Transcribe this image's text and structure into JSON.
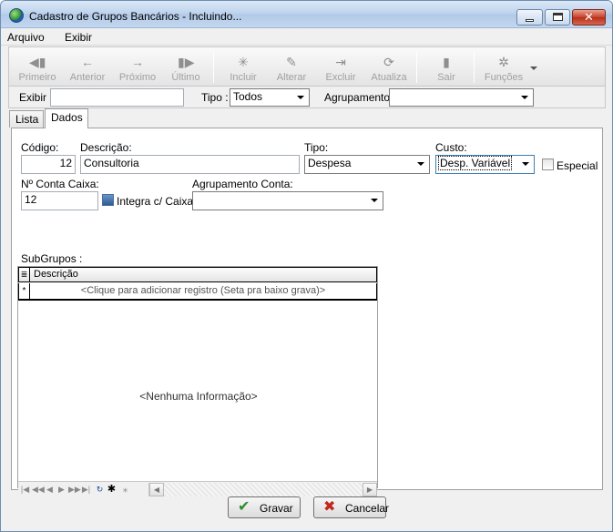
{
  "window": {
    "title": "Cadastro de Grupos Bancários - Incluindo..."
  },
  "menu": {
    "items": [
      "Arquivo",
      "Exibir"
    ]
  },
  "toolbar": {
    "buttons": [
      {
        "label": "Primeiro",
        "icon": "first-record-icon",
        "glyph": "◀▮"
      },
      {
        "label": "Anterior",
        "icon": "previous-arrow-icon",
        "glyph": "←"
      },
      {
        "label": "Próximo",
        "icon": "next-arrow-icon",
        "glyph": "→"
      },
      {
        "label": "Último",
        "icon": "last-record-icon",
        "glyph": "▮▶"
      },
      {
        "label": "Incluir",
        "icon": "new-record-icon",
        "glyph": "✳"
      },
      {
        "label": "Alterar",
        "icon": "edit-record-icon",
        "glyph": "✎"
      },
      {
        "label": "Excluir",
        "icon": "delete-record-icon",
        "glyph": "⇥"
      },
      {
        "label": "Atualiza",
        "icon": "refresh-icon",
        "glyph": "⟳"
      },
      {
        "label": "Sair",
        "icon": "exit-door-icon",
        "glyph": "▮"
      },
      {
        "label": "Funções",
        "icon": "functions-tools-icon",
        "glyph": "✲"
      }
    ]
  },
  "filter": {
    "exibir_label": "Exibir :",
    "exibir_value": "",
    "tipo_label": "Tipo :",
    "tipo_value": "Todos",
    "agrupamento_label": "Agrupamento:",
    "agrupamento_value": ""
  },
  "tabs": [
    {
      "label": "Lista"
    },
    {
      "label": "Dados"
    }
  ],
  "form": {
    "codigo_label": "Código:",
    "codigo_value": "12",
    "descricao_label": "Descrição:",
    "descricao_value": "Consultoria",
    "tipo_label": "Tipo:",
    "tipo_value": "Despesa",
    "custo_label": "Custo:",
    "custo_value": "Desp. Variável",
    "especial_label": "Especial",
    "conta_caixa_label": "Nº Conta Caixa:",
    "conta_caixa_value": "12",
    "integra_label": "Integra c/ Caixa",
    "agrupamento_conta_label": "Agrupamento Conta:",
    "agrupamento_conta_value": ""
  },
  "subgrupos": {
    "label": "SubGrupos :",
    "column_header": "Descrição",
    "new_row_hint": "<Clique para adicionar registro (Seta pra baixo grava)>",
    "new_row_marker": "*",
    "empty_message": "<Nenhuma Informação>"
  },
  "buttons": {
    "gravar": "Gravar",
    "cancelar": "Cancelar"
  },
  "colors": {
    "gravar_icon": "#2e8b2e",
    "cancelar_icon": "#c0281c",
    "title_gradient": "#bcd2ec"
  }
}
